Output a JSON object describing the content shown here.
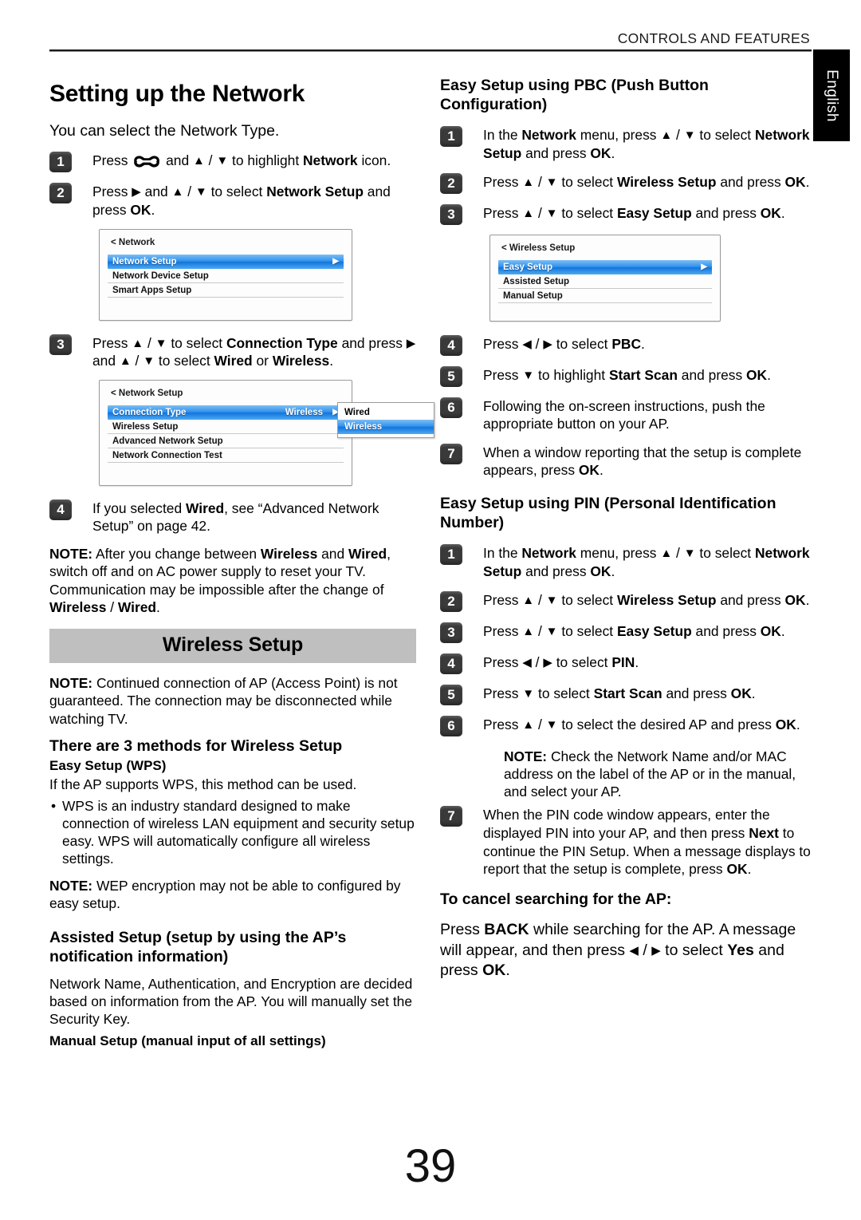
{
  "header": {
    "section_title": "CONTROLS AND FEATURES",
    "language_tab": "English"
  },
  "page_number": "39",
  "left_column": {
    "title": "Setting up the Network",
    "lead": "You can select the Network Type.",
    "steps": [
      {
        "num": "1",
        "text_parts": [
          {
            "t": "Press ",
            "b": false
          },
          {
            "t": "[wrench-icon]",
            "b": false
          },
          {
            "t": " and ",
            "b": false
          },
          {
            "t": "▲ / ▼",
            "b": false
          },
          {
            "t": " to highlight ",
            "b": false
          },
          {
            "t": "Network",
            "b": true
          },
          {
            "t": " icon.",
            "b": false
          }
        ]
      },
      {
        "num": "2",
        "text_parts": [
          {
            "t": "Press ",
            "b": false
          },
          {
            "t": "▶",
            "b": false
          },
          {
            "t": " and ",
            "b": false
          },
          {
            "t": "▲ / ▼",
            "b": false
          },
          {
            "t": " to select ",
            "b": false
          },
          {
            "t": "Network Setup",
            "b": true
          },
          {
            "t": " and press ",
            "b": false
          },
          {
            "t": "OK",
            "b": true
          },
          {
            "t": ".",
            "b": false
          }
        ]
      },
      {
        "num": "3",
        "text_parts": [
          {
            "t": "Press ",
            "b": false
          },
          {
            "t": "▲ / ▼",
            "b": false
          },
          {
            "t": " to select ",
            "b": false
          },
          {
            "t": "Connection Type",
            "b": true
          },
          {
            "t": " and press ",
            "b": false
          },
          {
            "t": "▶",
            "b": false
          },
          {
            "t": " and ",
            "b": false
          },
          {
            "t": "▲ / ▼",
            "b": false
          },
          {
            "t": " to select ",
            "b": false
          },
          {
            "t": "Wired",
            "b": true
          },
          {
            "t": " or ",
            "b": false
          },
          {
            "t": "Wireless",
            "b": true
          },
          {
            "t": ".",
            "b": false
          }
        ]
      },
      {
        "num": "4",
        "text_parts": [
          {
            "t": "If you selected ",
            "b": false
          },
          {
            "t": "Wired",
            "b": true
          },
          {
            "t": ", see “Advanced Network Setup” on page 42.",
            "b": false
          }
        ]
      }
    ],
    "osd_network": {
      "breadcrumb": "< Network",
      "items": [
        {
          "label": "Network Setup",
          "selected": true,
          "caret": "▶"
        },
        {
          "label": "Network Device Setup",
          "selected": false
        },
        {
          "label": "Smart Apps Setup",
          "selected": false
        }
      ]
    },
    "osd_network_setup": {
      "breadcrumb": "< Network Setup",
      "items": [
        {
          "label": "Connection Type",
          "value": "Wireless",
          "selected": true,
          "caret": "▶"
        },
        {
          "label": "Wireless Setup",
          "selected": false
        },
        {
          "label": "Advanced Network Setup",
          "selected": false
        },
        {
          "label": "Network Connection Test",
          "selected": false
        }
      ],
      "popup": [
        {
          "label": "Wired",
          "selected": false
        },
        {
          "label": "Wireless",
          "selected": true
        }
      ]
    },
    "note_wired_wireless": {
      "label": "NOTE:",
      "parts": [
        {
          "t": "  After you change between ",
          "b": false
        },
        {
          "t": "Wireless",
          "b": true
        },
        {
          "t": " and ",
          "b": false
        },
        {
          "t": "Wired",
          "b": true
        },
        {
          "t": ", switch off and on AC power supply to reset your TV. Communication may be impossible after the change of ",
          "b": false
        },
        {
          "t": "Wireless",
          "b": true
        },
        {
          "t": " / ",
          "b": false
        },
        {
          "t": "Wired",
          "b": true
        },
        {
          "t": ".",
          "b": false
        }
      ]
    },
    "banner": "Wireless Setup",
    "note_ap": {
      "label": "NOTE:",
      "text": " Continued connection of AP (Access Point) is not guaranteed. The connection may be disconnected while watching TV."
    },
    "methods_heading": "There are 3 methods for Wireless Setup",
    "method_1_heading": "Easy Setup (WPS)",
    "method_1_body": "If the AP supports WPS, this method can be used.",
    "method_1_bullet": "WPS is an industry standard designed to make connection of wireless LAN equipment and security setup easy. WPS will automatically configure all wireless settings.",
    "note_wep": {
      "label": "NOTE:",
      "text": "  WEP encryption may not be able to configured by easy setup."
    },
    "method_2_heading": "Assisted Setup (setup by using the AP’s notification information)",
    "method_2_body": "Network Name, Authentication, and Encryption are decided based on information from the AP. You will manually set the Security Key.",
    "method_3_heading": "Manual Setup (manual input of all settings)"
  },
  "right_column": {
    "pbc_heading": "Easy Setup using PBC (Push Button Configuration)",
    "pbc_steps": [
      {
        "num": "1",
        "text_parts": [
          {
            "t": "In the ",
            "b": false
          },
          {
            "t": "Network",
            "b": true
          },
          {
            "t": " menu, press ",
            "b": false
          },
          {
            "t": "▲ / ▼",
            "b": false
          },
          {
            "t": " to select ",
            "b": false
          },
          {
            "t": "Network Setup",
            "b": true
          },
          {
            "t": " and press ",
            "b": false
          },
          {
            "t": "OK",
            "b": true
          },
          {
            "t": ".",
            "b": false
          }
        ]
      },
      {
        "num": "2",
        "text_parts": [
          {
            "t": "Press ",
            "b": false
          },
          {
            "t": "▲ / ▼",
            "b": false
          },
          {
            "t": " to select ",
            "b": false
          },
          {
            "t": "Wireless Setup",
            "b": true
          },
          {
            "t": " and press ",
            "b": false
          },
          {
            "t": "OK",
            "b": true
          },
          {
            "t": ".",
            "b": false
          }
        ]
      },
      {
        "num": "3",
        "text_parts": [
          {
            "t": "Press ",
            "b": false
          },
          {
            "t": "▲ / ▼",
            "b": false
          },
          {
            "t": " to select ",
            "b": false
          },
          {
            "t": "Easy Setup",
            "b": true
          },
          {
            "t": " and press ",
            "b": false
          },
          {
            "t": "OK",
            "b": true
          },
          {
            "t": ".",
            "b": false
          }
        ]
      },
      {
        "num": "4",
        "text_parts": [
          {
            "t": "Press ",
            "b": false
          },
          {
            "t": "◀ / ▶",
            "b": false
          },
          {
            "t": " to select ",
            "b": false
          },
          {
            "t": "PBC",
            "b": true
          },
          {
            "t": ".",
            "b": false
          }
        ]
      },
      {
        "num": "5",
        "text_parts": [
          {
            "t": "Press ",
            "b": false
          },
          {
            "t": "▼",
            "b": false
          },
          {
            "t": " to highlight ",
            "b": false
          },
          {
            "t": "Start Scan",
            "b": true
          },
          {
            "t": " and press ",
            "b": false
          },
          {
            "t": "OK",
            "b": true
          },
          {
            "t": ".",
            "b": false
          }
        ]
      },
      {
        "num": "6",
        "text_parts": [
          {
            "t": "Following the on-screen instructions, push the appropriate button on your AP.",
            "b": false
          }
        ]
      },
      {
        "num": "7",
        "text_parts": [
          {
            "t": "When a window reporting that the setup is complete appears, press ",
            "b": false
          },
          {
            "t": "OK",
            "b": true
          },
          {
            "t": ".",
            "b": false
          }
        ]
      }
    ],
    "osd_wireless_setup": {
      "breadcrumb": "< Wireless Setup",
      "items": [
        {
          "label": "Easy Setup",
          "selected": true,
          "caret": "▶"
        },
        {
          "label": "Assisted Setup",
          "selected": false
        },
        {
          "label": "Manual Setup",
          "selected": false
        }
      ]
    },
    "pin_heading": "Easy Setup using PIN (Personal Identification Number)",
    "pin_steps": [
      {
        "num": "1",
        "text_parts": [
          {
            "t": "In the ",
            "b": false
          },
          {
            "t": "Network",
            "b": true
          },
          {
            "t": " menu, press ",
            "b": false
          },
          {
            "t": "▲ / ▼",
            "b": false
          },
          {
            "t": " to select ",
            "b": false
          },
          {
            "t": "Network Setup",
            "b": true
          },
          {
            "t": " and press ",
            "b": false
          },
          {
            "t": "OK",
            "b": true
          },
          {
            "t": ".",
            "b": false
          }
        ]
      },
      {
        "num": "2",
        "text_parts": [
          {
            "t": "Press ",
            "b": false
          },
          {
            "t": "▲ / ▼",
            "b": false
          },
          {
            "t": " to select ",
            "b": false
          },
          {
            "t": "Wireless Setup",
            "b": true
          },
          {
            "t": " and press ",
            "b": false
          },
          {
            "t": "OK",
            "b": true
          },
          {
            "t": ".",
            "b": false
          }
        ]
      },
      {
        "num": "3",
        "text_parts": [
          {
            "t": "Press ",
            "b": false
          },
          {
            "t": "▲ / ▼",
            "b": false
          },
          {
            "t": " to select ",
            "b": false
          },
          {
            "t": "Easy Setup",
            "b": true
          },
          {
            "t": " and press ",
            "b": false
          },
          {
            "t": "OK",
            "b": true
          },
          {
            "t": ".",
            "b": false
          }
        ]
      },
      {
        "num": "4",
        "text_parts": [
          {
            "t": "Press ",
            "b": false
          },
          {
            "t": "◀ / ▶",
            "b": false
          },
          {
            "t": " to select ",
            "b": false
          },
          {
            "t": "PIN",
            "b": true
          },
          {
            "t": ".",
            "b": false
          }
        ]
      },
      {
        "num": "5",
        "text_parts": [
          {
            "t": "Press ",
            "b": false
          },
          {
            "t": "▼",
            "b": false
          },
          {
            "t": " to select ",
            "b": false
          },
          {
            "t": "Start Scan",
            "b": true
          },
          {
            "t": " and press ",
            "b": false
          },
          {
            "t": "OK",
            "b": true
          },
          {
            "t": ".",
            "b": false
          }
        ]
      },
      {
        "num": "6",
        "text_parts": [
          {
            "t": "Press ",
            "b": false
          },
          {
            "t": "▲ / ▼",
            "b": false
          },
          {
            "t": " to select the desired AP and press ",
            "b": false
          },
          {
            "t": "OK",
            "b": true
          },
          {
            "t": ".",
            "b": false
          }
        ]
      },
      {
        "num": "7",
        "text_parts": [
          {
            "t": "When the PIN code window appears, enter the displayed PIN into your AP, and then press ",
            "b": false
          },
          {
            "t": "Next",
            "b": true
          },
          {
            "t": " to continue the PIN Setup. When a message displays to report that the setup is complete, press ",
            "b": false
          },
          {
            "t": "OK",
            "b": true
          },
          {
            "t": ".",
            "b": false
          }
        ]
      }
    ],
    "note_mac": {
      "label": "NOTE:",
      "text": " Check the Network Name and/or MAC address on the label of the AP or in the manual, and select your AP."
    },
    "cancel_heading": "To cancel searching for the AP:",
    "cancel_body_parts": [
      {
        "t": "Press ",
        "b": false
      },
      {
        "t": "BACK",
        "b": true
      },
      {
        "t": " while searching for the AP. A message will appear, and then press ",
        "b": false
      },
      {
        "t": "◀ / ▶",
        "b": false
      },
      {
        "t": " to select ",
        "b": false
      },
      {
        "t": "Yes",
        "b": true
      },
      {
        "t": " and press ",
        "b": false
      },
      {
        "t": "OK",
        "b": true
      },
      {
        "t": ".",
        "b": false
      }
    ]
  },
  "colors": {
    "menu_highlight": "#1274db",
    "banner_bg": "#bfbfbf",
    "lang_tab_bg": "#000000",
    "step_badge_bg": "#3a3a3a"
  }
}
